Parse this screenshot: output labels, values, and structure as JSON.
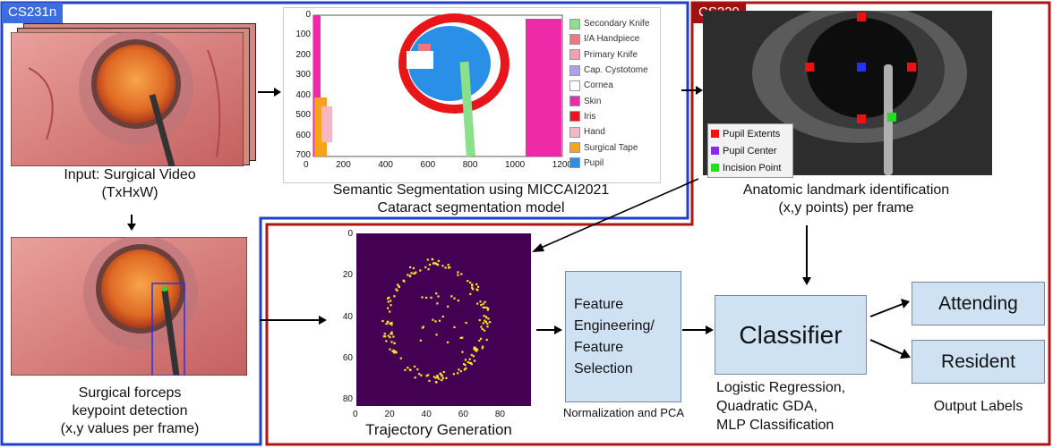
{
  "regions": {
    "cs231n_label": "CS231n",
    "cs229_label": "CS229",
    "cs231n_color": "#1f3fcc",
    "cs229_color": "#b01515"
  },
  "input_video": {
    "caption_line1": "Input: Surgical Video",
    "caption_line2": "(TxHxW)"
  },
  "segmentation": {
    "caption_line1": "Semantic Segmentation using MICCAI2021",
    "caption_line2": "Cataract segmentation model",
    "x_ticks": [
      "0",
      "200",
      "400",
      "600",
      "800",
      "1000",
      "1200"
    ],
    "y_ticks": [
      "0",
      "100",
      "200",
      "300",
      "400",
      "500",
      "600",
      "700"
    ],
    "legend": [
      {
        "label": "Secondary Knife",
        "color": "#8be08b"
      },
      {
        "label": "I/A Handpiece",
        "color": "#f0777f"
      },
      {
        "label": "Primary Knife",
        "color": "#f3a0b0"
      },
      {
        "label": "Cap. Cystotome",
        "color": "#a9a3e6"
      },
      {
        "label": "Cornea",
        "color": "#ffffff"
      },
      {
        "label": "Skin",
        "color": "#ef2aa8"
      },
      {
        "label": "Iris",
        "color": "#e8151a"
      },
      {
        "label": "Hand",
        "color": "#f5b7c4"
      },
      {
        "label": "Surgical Tape",
        "color": "#f7a21b"
      },
      {
        "label": "Pupil",
        "color": "#2a8fe6"
      }
    ]
  },
  "landmarks": {
    "caption_line1": "Anatomic landmark identification",
    "caption_line2": "(x,y points) per frame",
    "legend": [
      {
        "label": "Pupil Extents",
        "color": "#ee1111"
      },
      {
        "label": "Pupil Center",
        "color": "#8a2be2"
      },
      {
        "label": "Incision Point",
        "color": "#22dd22"
      }
    ]
  },
  "forceps": {
    "caption_line1": "Surgical forceps",
    "caption_line2": "keypoint detection",
    "caption_line3": "(x,y values per frame)"
  },
  "trajectory": {
    "caption": "Trajectory Generation",
    "x_ticks": [
      "0",
      "20",
      "40",
      "60",
      "80"
    ],
    "y_ticks": [
      "0",
      "20",
      "40",
      "60",
      "80"
    ]
  },
  "feature": {
    "line1": "Feature",
    "line2": "Engineering/",
    "line3": "Feature",
    "line4": "Selection",
    "caption": "Normalization and PCA"
  },
  "classifier": {
    "label": "Classifier",
    "caption_line1": "Logistic Regression,",
    "caption_line2": "Quadratic GDA,",
    "caption_line3": "MLP Classification"
  },
  "outputs": {
    "attending": "Attending",
    "resident": "Resident",
    "caption": "Output Labels"
  }
}
